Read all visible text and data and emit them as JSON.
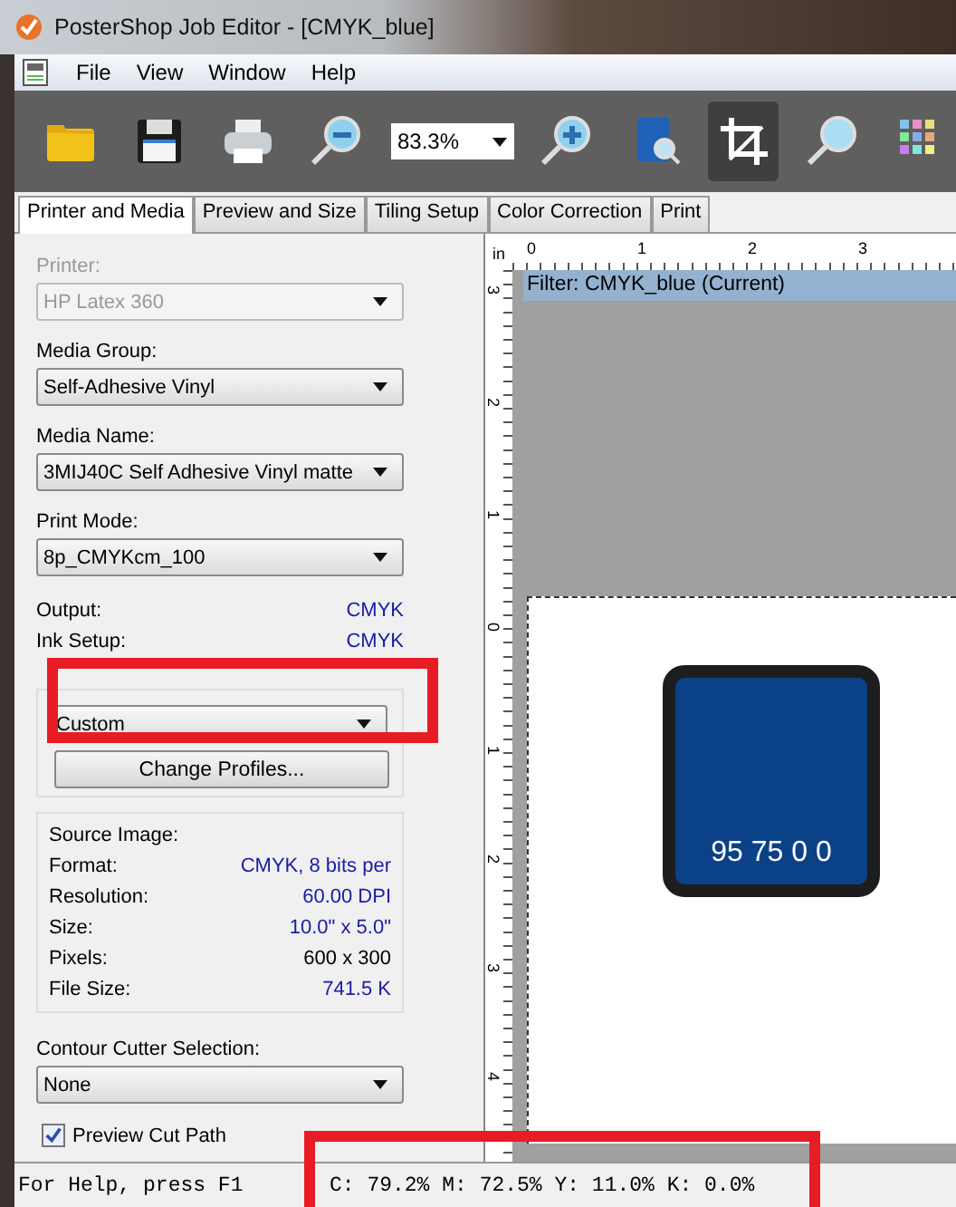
{
  "window": {
    "title": "PosterShop Job Editor - [CMYK_blue]"
  },
  "menu": [
    "File",
    "View",
    "Window",
    "Help"
  ],
  "toolbar": [
    {
      "kind": "button",
      "selected": false
    },
    {
      "kind": "button",
      "selected": false
    },
    {
      "kind": "button",
      "selected": false
    },
    {
      "kind": "button",
      "selected": false
    },
    {
      "kind": "zoom",
      "value": "83.3%"
    },
    {
      "kind": "button",
      "selected": false
    },
    {
      "kind": "button",
      "selected": false
    },
    {
      "kind": "button",
      "selected": true
    },
    {
      "kind": "button",
      "selected": false
    },
    {
      "kind": "button",
      "selected": false
    }
  ],
  "tabs": [
    {
      "label": "Printer and Media",
      "selected": true
    },
    {
      "label": "Preview and Size",
      "selected": false
    },
    {
      "label": "Tiling Setup",
      "selected": false
    },
    {
      "label": "Color Correction",
      "selected": false
    },
    {
      "label": "Print",
      "selected": false
    }
  ],
  "printer": {
    "label": "Printer:",
    "value": "HP Latex 360",
    "disabled": true
  },
  "fields": [
    {
      "label": "Media Group:",
      "value": "Self-Adhesive Vinyl"
    },
    {
      "label": "Media Name:",
      "value": "3MIJ40C Self Adhesive Vinyl matte"
    },
    {
      "label": "Print Mode:",
      "value": "8p_CMYKcm_100"
    }
  ],
  "outputs": [
    {
      "label": "Output:",
      "value": "CMYK"
    },
    {
      "label": "Ink Setup:",
      "value": "CMYK"
    }
  ],
  "color_management": {
    "value": "Custom",
    "button": "Change Profiles..."
  },
  "source_image": {
    "title": "Source Image:",
    "rows": [
      {
        "label": "Format:",
        "value": "CMYK, 8 bits per",
        "color": "#1a1aa6"
      },
      {
        "label": "Resolution:",
        "value": "60.00 DPI",
        "color": "#1a1aa6"
      },
      {
        "label": "Size:",
        "value": "10.0\" x 5.0\"",
        "color": "#1a1aa6"
      },
      {
        "label": "Pixels:",
        "value": "600 x 300",
        "color": "#000000"
      },
      {
        "label": "File Size:",
        "value": "741.5 K",
        "color": "#1a1aa6"
      }
    ]
  },
  "contour": {
    "label": "Contour Cutter Selection:",
    "value": "None"
  },
  "preview_cut_path": {
    "label": "Preview Cut Path",
    "checked": true
  },
  "preview": {
    "unit": "in",
    "top_ruler": [
      "0",
      "1",
      "2",
      "3"
    ],
    "left_ruler": [
      "3",
      "2",
      "1",
      "0",
      "1",
      "2",
      "3",
      "4"
    ],
    "filter": "Filter: CMYK_blue (Current)",
    "swatch": {
      "color": "#0b4287",
      "label": "95 75 0 0"
    }
  },
  "status_bar": {
    "help": "For Help, press F1",
    "readout": "C: 79.2% M: 72.5% Y: 11.0% K:  0.0%"
  }
}
